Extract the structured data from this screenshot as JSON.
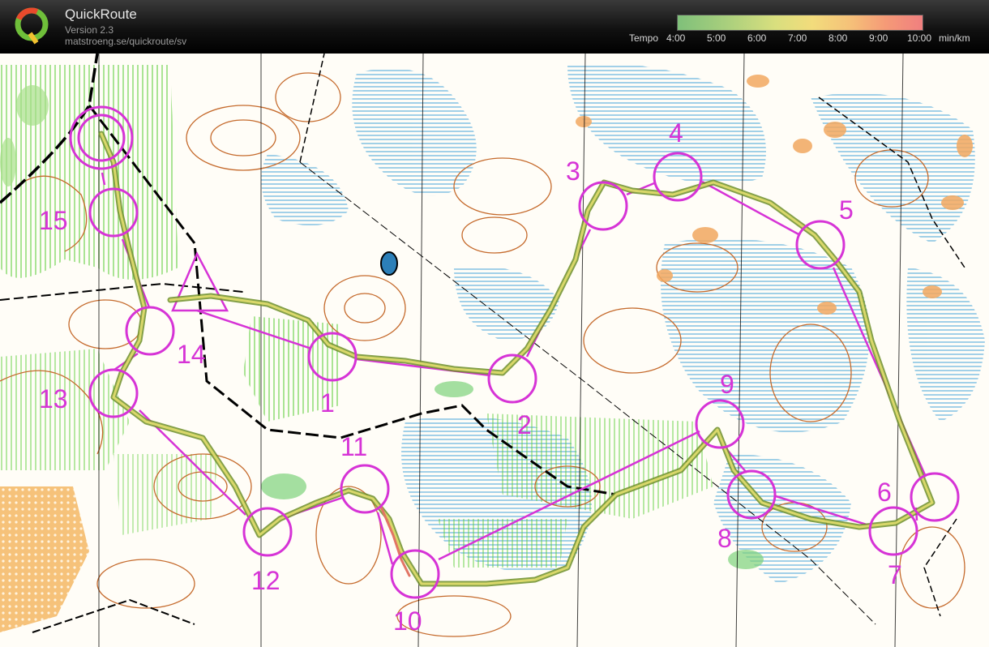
{
  "app": {
    "title": "QuickRoute",
    "version": "Version 2.3",
    "url": "matstroeng.se/quickroute/sv",
    "logo_letter": "Q"
  },
  "tempo_scale": {
    "label": "Tempo",
    "ticks": [
      "4:00",
      "5:00",
      "6:00",
      "7:00",
      "8:00",
      "9:00",
      "10:00"
    ],
    "unit": "min/km"
  },
  "map": {
    "course_color": "#d633d6",
    "route_color": "#8fb04a",
    "controls": [
      "15",
      "14",
      "13",
      "1",
      "2",
      "3",
      "4",
      "5",
      "6",
      "7",
      "8",
      "9",
      "10",
      "11",
      "12"
    ]
  }
}
